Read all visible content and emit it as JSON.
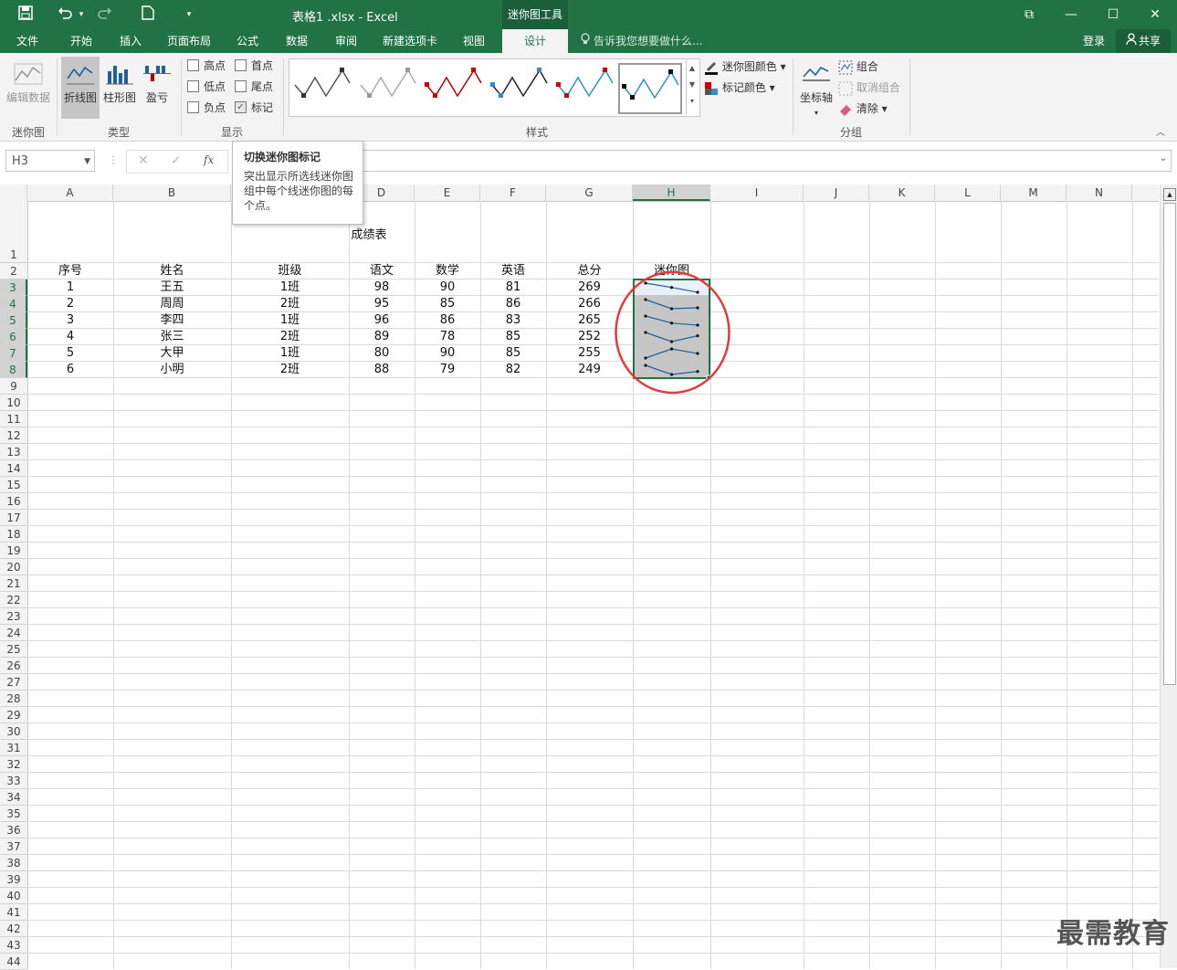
{
  "titlebar": {
    "title": "表格1 .xlsx - Excel",
    "contextual_tab": "迷你图工具",
    "save_icon": "save-icon",
    "undo_icon": "undo-icon",
    "redo_icon": "redo-icon",
    "new_icon": "new-doc-icon",
    "qat_menu": "▾",
    "restore_glyph": "⧉",
    "minimize_glyph": "—",
    "maximize_glyph": "☐",
    "close_glyph": "✕"
  },
  "tabs": [
    "文件",
    "开始",
    "插入",
    "页面布局",
    "公式",
    "数据",
    "审阅",
    "新建选项卡",
    "视图",
    "设计"
  ],
  "tell_me": "告诉我您想要做什么...",
  "account": {
    "login": "登录",
    "share": "共享"
  },
  "ribbon": {
    "edit_data": "编辑数据",
    "group_sparkline": "迷你图",
    "type_line": "折线图",
    "type_column": "柱形图",
    "type_winloss": "盈亏",
    "group_type": "类型",
    "show": {
      "high": "高点",
      "first": "首点",
      "low": "低点",
      "last": "尾点",
      "negative": "负点",
      "markers": "标记",
      "markers_checked": true,
      "check_glyph": "✓"
    },
    "group_show": "显示",
    "group_style": "样式",
    "sparkline_color": "迷你图颜色",
    "marker_color": "标记颜色",
    "axis": "坐标轴",
    "group": "组合",
    "ungroup": "取消组合",
    "clear": "清除",
    "group_group": "分组"
  },
  "formula_bar": {
    "name_box": "H3",
    "fx": "fx",
    "cancel": "✕",
    "enter": "✓",
    "value": ""
  },
  "tooltip": {
    "title": "切换迷你图标记",
    "body": "突出显示所选线迷你图组中每个线迷你图的每个点。"
  },
  "columns": [
    "A",
    "B",
    "C",
    "D",
    "E",
    "F",
    "G",
    "H",
    "I",
    "J",
    "K",
    "L",
    "M",
    "N"
  ],
  "sheet": {
    "title": "成绩表",
    "headers": [
      "序号",
      "姓名",
      "班级",
      "语文",
      "数学",
      "英语",
      "总分",
      "迷你图"
    ],
    "rows": [
      [
        "1",
        "王五",
        "1班",
        "98",
        "90",
        "81",
        "269"
      ],
      [
        "2",
        "周周",
        "2班",
        "95",
        "85",
        "86",
        "266"
      ],
      [
        "3",
        "李四",
        "1班",
        "96",
        "86",
        "83",
        "265"
      ],
      [
        "4",
        "张三",
        "2班",
        "89",
        "78",
        "85",
        "252"
      ],
      [
        "5",
        "大甲",
        "1班",
        "80",
        "90",
        "85",
        "255"
      ],
      [
        "6",
        "小明",
        "2班",
        "88",
        "79",
        "82",
        "249"
      ]
    ]
  },
  "sparklines": [
    [
      98,
      90,
      81
    ],
    [
      95,
      85,
      86
    ],
    [
      96,
      86,
      83
    ],
    [
      89,
      78,
      85
    ],
    [
      80,
      90,
      85
    ],
    [
      88,
      79,
      82
    ]
  ],
  "colors": {
    "excel_green": "#217346",
    "sparkline": "#1f5f9e",
    "marker": "#111111",
    "highlight_circle": "#e63a3a"
  },
  "watermark": "最需教育"
}
